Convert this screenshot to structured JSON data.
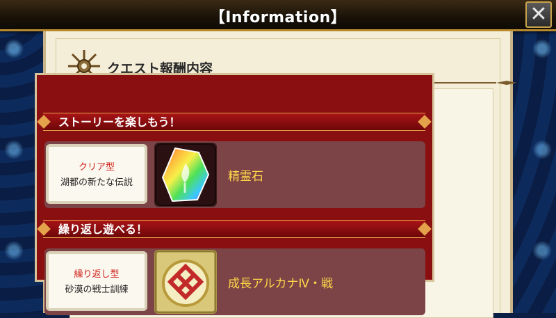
{
  "header": {
    "title": "【Information】",
    "close_symbol": "✕"
  },
  "section": {
    "title": "クエスト報酬内容"
  },
  "groups": [
    {
      "banner": "ストーリーを楽しもう！",
      "quest_type": "クリア型",
      "quest_name": "湖都の新たな伝説",
      "reward_name": "精霊石",
      "reward_icon": "rainbow-crystal-icon"
    },
    {
      "banner": "繰り返し遊べる！",
      "quest_type": "繰り返し型",
      "quest_name": "砂漠の戦士訓練",
      "reward_name": "成長アルカナⅣ・戦",
      "reward_icon": "arcana-emblem-icon"
    }
  ],
  "colors": {
    "background": "#0b1f45",
    "panel": "#f4eed8",
    "reward_area": "#8a0f10",
    "banner": "#a81416",
    "quest_type_text": "#d0231e",
    "reward_text": "#ffd84a"
  }
}
